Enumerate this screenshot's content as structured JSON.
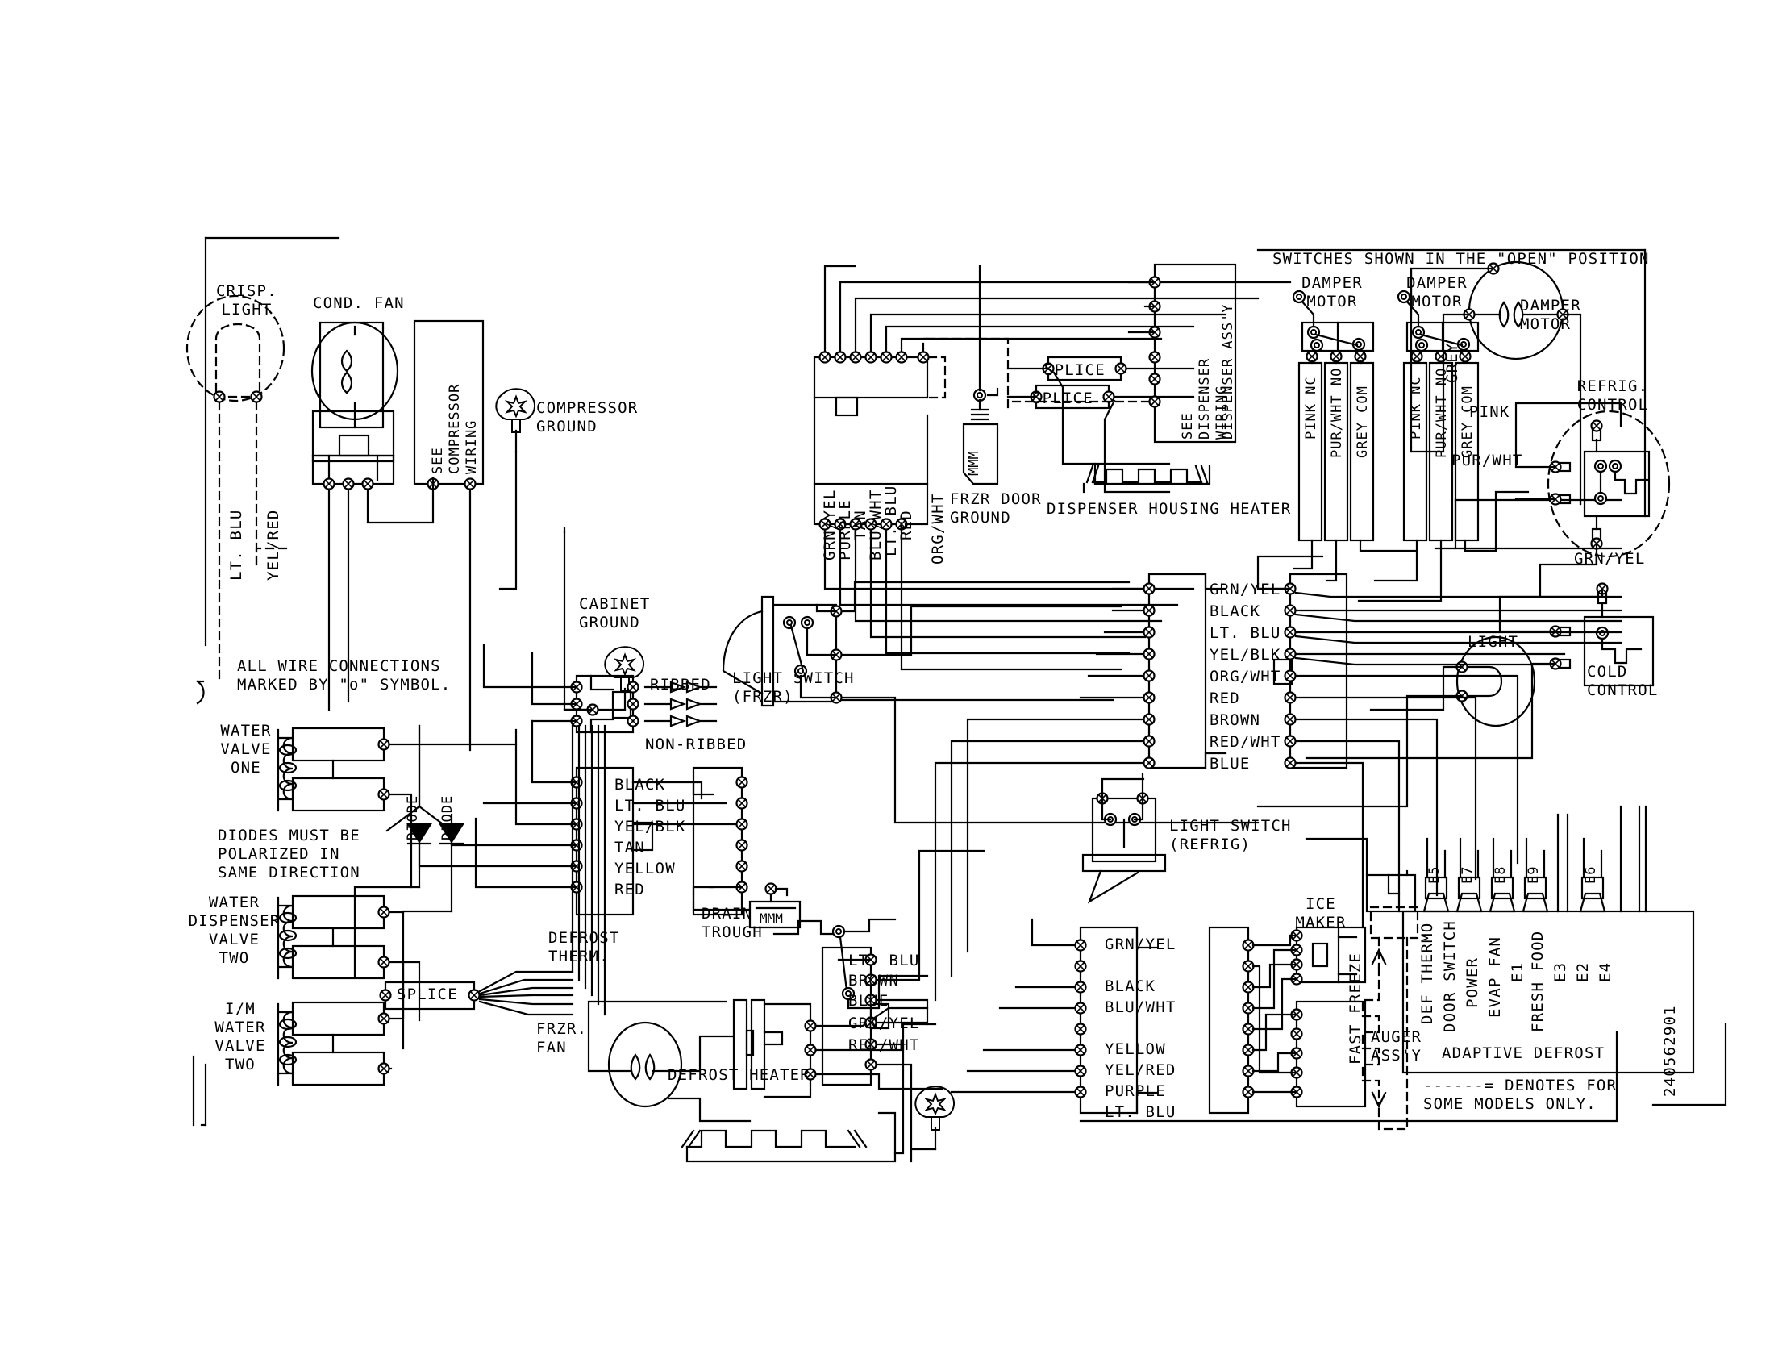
{
  "document": {
    "type": "refrigerator-wiring-diagram",
    "drawing_number": "240562901",
    "notes": [
      "ALL WIRE CONNECTIONS\nMARKED BY \"o\" SYMBOL.",
      "DIODES MUST BE\nPOLARIZED IN\nSAME DIRECTION",
      "SWITCHES SHOWN IN THE \"OPEN\" POSITION",
      "------= DENOTES FOR\nSOME MODELS ONLY."
    ]
  },
  "components": {
    "crisp_light": "CRISP.\nLIGHT",
    "cond_fan": "COND. FAN",
    "see_compressor_wiring": "SEE\nCOMPRESSOR\nWIRING",
    "compressor_ground": "COMPRESSOR\nGROUND",
    "cabinet_ground": "CABINET\nGROUND",
    "water_valve_one": "WATER\nVALVE\nONE",
    "water_dispenser_valve_two": "WATER\nDISPENSER\nVALVE\nTWO",
    "im_water_valve_two": "I/M\nWATER\nVALVE\nTWO",
    "diode_left": "DIODE",
    "diode_right": "DIODE",
    "splice_left": "SPLICE",
    "splice_top_a": "SPLICE",
    "splice_top_b": "SPLICE",
    "ribbed": "RIBBED",
    "non_ribbed": "NON-RIBBED",
    "light_switch_frzr": "LIGHT SWITCH\n(FRZR)",
    "light_switch_refrig": "LIGHT SWITCH\n(REFRIG)",
    "drain_trough": "DRAIN\nTROUGH",
    "defrost_therm": "DEFROST\nTHERM.",
    "frzr_fan": "FRZR.\nFAN",
    "defrost_heater": "DEFROST HEATER",
    "frzr_door_ground": "FRZR DOOR\nGROUND",
    "dispenser_housing_heater": "DISPENSER HOUSING HEATER",
    "see_dispenser_assy_wiring": "SEE\nDISPENSER\nWIRING",
    "dispenser_assy": "DISPENSER ASS'Y",
    "damper_motor_1": "DAMPER\nMOTOR",
    "damper_motor_2": "DAMPER\nMOTOR",
    "damper_motor_3": "DAMPER\nMOTOR",
    "refrig_control": "REFRIG.\nCONTROL",
    "cold_control": "COLD\nCONTROL",
    "light": "LIGHT",
    "ice_maker": "ICE\nMAKER",
    "auger_assy": "AUGER\nASS'Y",
    "fast_freeze": "FAST FREEZE",
    "adaptive_defrost": "ADAPTIVE DEFROST"
  },
  "wire_labels": {
    "crisp_light": [
      "LT. BLU",
      "YEL/RED"
    ],
    "damper_1": [
      "PINK NC",
      "PUR/WHT NO",
      "GREY COM"
    ],
    "damper_2": [
      "PINK NC",
      "PUR/WHT NO",
      "GREY COM"
    ],
    "damper_motor_3_lead": "GREY",
    "to_refrig_control": [
      "PINK",
      "PUR/WHT"
    ],
    "refrig_control_ground": "GRN/YEL",
    "frzr_door_harness": [
      "GRN/YEL",
      "PURPLE",
      "TAN",
      "BLU/WHT",
      "LT. BLU",
      "RED",
      "ORG/WHT"
    ],
    "center_block_left": [
      "BLACK",
      "LT. BLU",
      "YEL/BLK",
      "TAN",
      "YELLOW",
      "RED"
    ],
    "main_block": [
      "GRN/YEL",
      "BLACK",
      "LT. BLU",
      "YEL/BLK",
      "ORG/WHT",
      "RED",
      "BROWN",
      "RED/WHT",
      "BLUE"
    ],
    "defrost_block": [
      "LT. BLU",
      "BROWN",
      "BLUE",
      "GRN/YEL",
      "RED/WHT"
    ],
    "icemaker_block": [
      "GRN/YEL",
      "BLACK",
      "BLU/WHT",
      "YELLOW",
      "YEL/RED",
      "PURPLE",
      "LT. BLU"
    ]
  },
  "adaptive_defrost": {
    "title": "ADAPTIVE DEFROST",
    "tabs": [
      "E5",
      "E7",
      "E8",
      "E9",
      "E6"
    ],
    "pin_labels": [
      "DEF THERMO",
      "DOOR SWITCH",
      "POWER",
      "EVAP FAN",
      "E1",
      "FRESH FOOD",
      "E3",
      "E2",
      "E4"
    ]
  }
}
